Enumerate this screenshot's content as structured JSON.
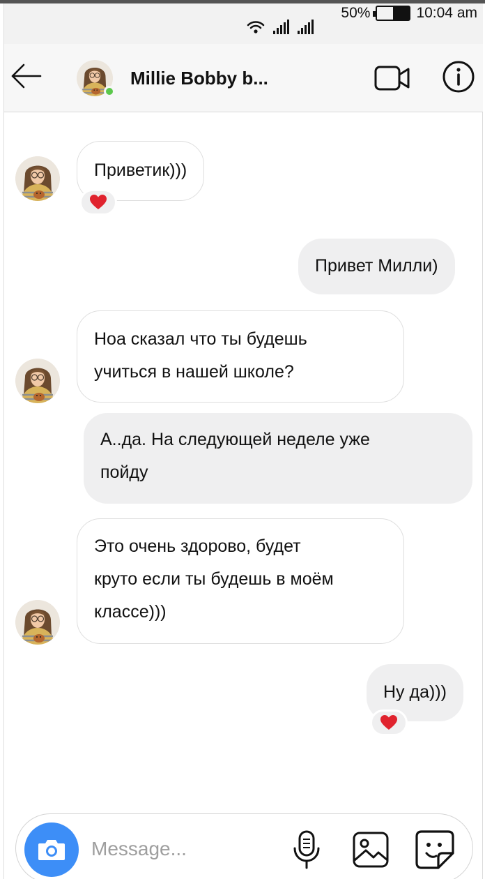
{
  "status_bar": {
    "battery_percent": "50%",
    "battery_level": 0.5,
    "time": "10:04 am",
    "icons": [
      "wifi-icon",
      "signal-icon",
      "signal-icon"
    ]
  },
  "header": {
    "contact_name": "Millie Bobby b...",
    "online": true,
    "icons": [
      "back-arrow-icon",
      "video-call-icon",
      "info-icon"
    ]
  },
  "messages": [
    {
      "direction": "incoming",
      "text": "Приветик)))",
      "reaction": "❤️"
    },
    {
      "direction": "outgoing",
      "text": "Привет Милли)"
    },
    {
      "direction": "incoming",
      "lines": [
        "Ноа сказал что ты будешь",
        "учиться в нашей школе?"
      ]
    },
    {
      "direction": "outgoing",
      "lines": [
        "А..да. На следующей неделе уже",
        "пойду"
      ]
    },
    {
      "direction": "incoming",
      "lines": [
        "Это очень здорово, будет",
        "круто если ты будешь в моём",
        "классе)))"
      ]
    },
    {
      "direction": "outgoing",
      "text": "Ну да)))",
      "reaction": "❤️"
    }
  ],
  "composer": {
    "placeholder": "Message...",
    "icons": [
      "camera-icon",
      "microphone-icon",
      "gallery-icon",
      "sticker-icon"
    ]
  },
  "colors": {
    "accent": "#3d8ef7",
    "online_dot": "#5bc84b",
    "outgoing_bubble": "#efeff0",
    "incoming_border": "#dedede",
    "reaction_heart": "#e0232e"
  }
}
